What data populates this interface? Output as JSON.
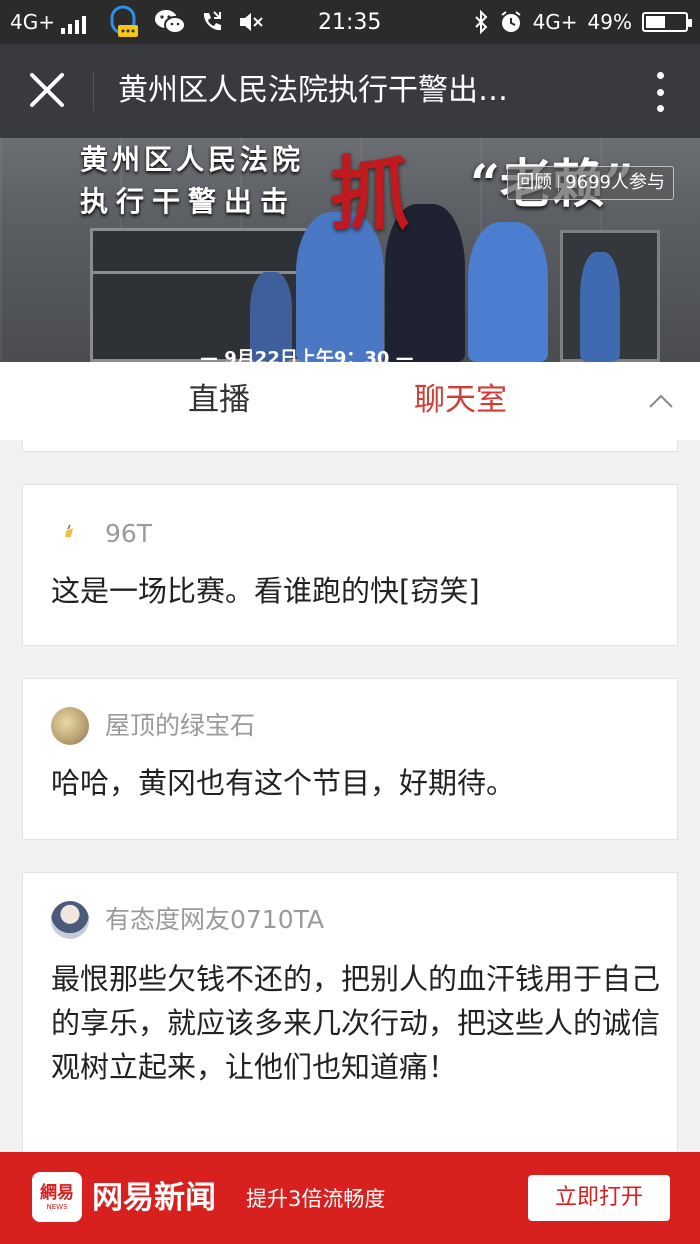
{
  "status_bar": {
    "network_left": "4G+",
    "time": "21:35",
    "network_right": "4G+",
    "battery_percent": "49%",
    "battery_level": 0.49
  },
  "title_bar": {
    "title": "黄州区人民法院执行干警出…"
  },
  "banner": {
    "line1": "黄州区人民法院",
    "line2": "执行干警出击",
    "big_char": "抓",
    "quote": "“老赖”",
    "review_label": "回顾",
    "participants": "9699人参与",
    "date": "— 9月22日上午9：30 —"
  },
  "tabs": {
    "live": "直播",
    "chat": "聊天室"
  },
  "colors": {
    "accent_red": "#d43c33",
    "app_banner_red": "#d8201f",
    "title_bar_bg": "#393a3f"
  },
  "comments": [
    {
      "user": "96T",
      "text": "这是一场比赛。看谁跑的快[窃笑]"
    },
    {
      "user": "屋顶的绿宝石",
      "text": "哈哈，黄冈也有这个节目，好期待。"
    },
    {
      "user": "有态度网友0710TA",
      "text": "最恨那些欠钱不还的，把别人的血汗钱用于自己的享乐，就应该多来几次行动，把这些人的诚信观树立起来，让他们也知道痛！"
    }
  ],
  "app_banner": {
    "logo_text": "網易",
    "logo_sub": "NEWS",
    "name": "网易新闻",
    "tagline": "提升3倍流畅度",
    "open_button": "立即打开"
  }
}
